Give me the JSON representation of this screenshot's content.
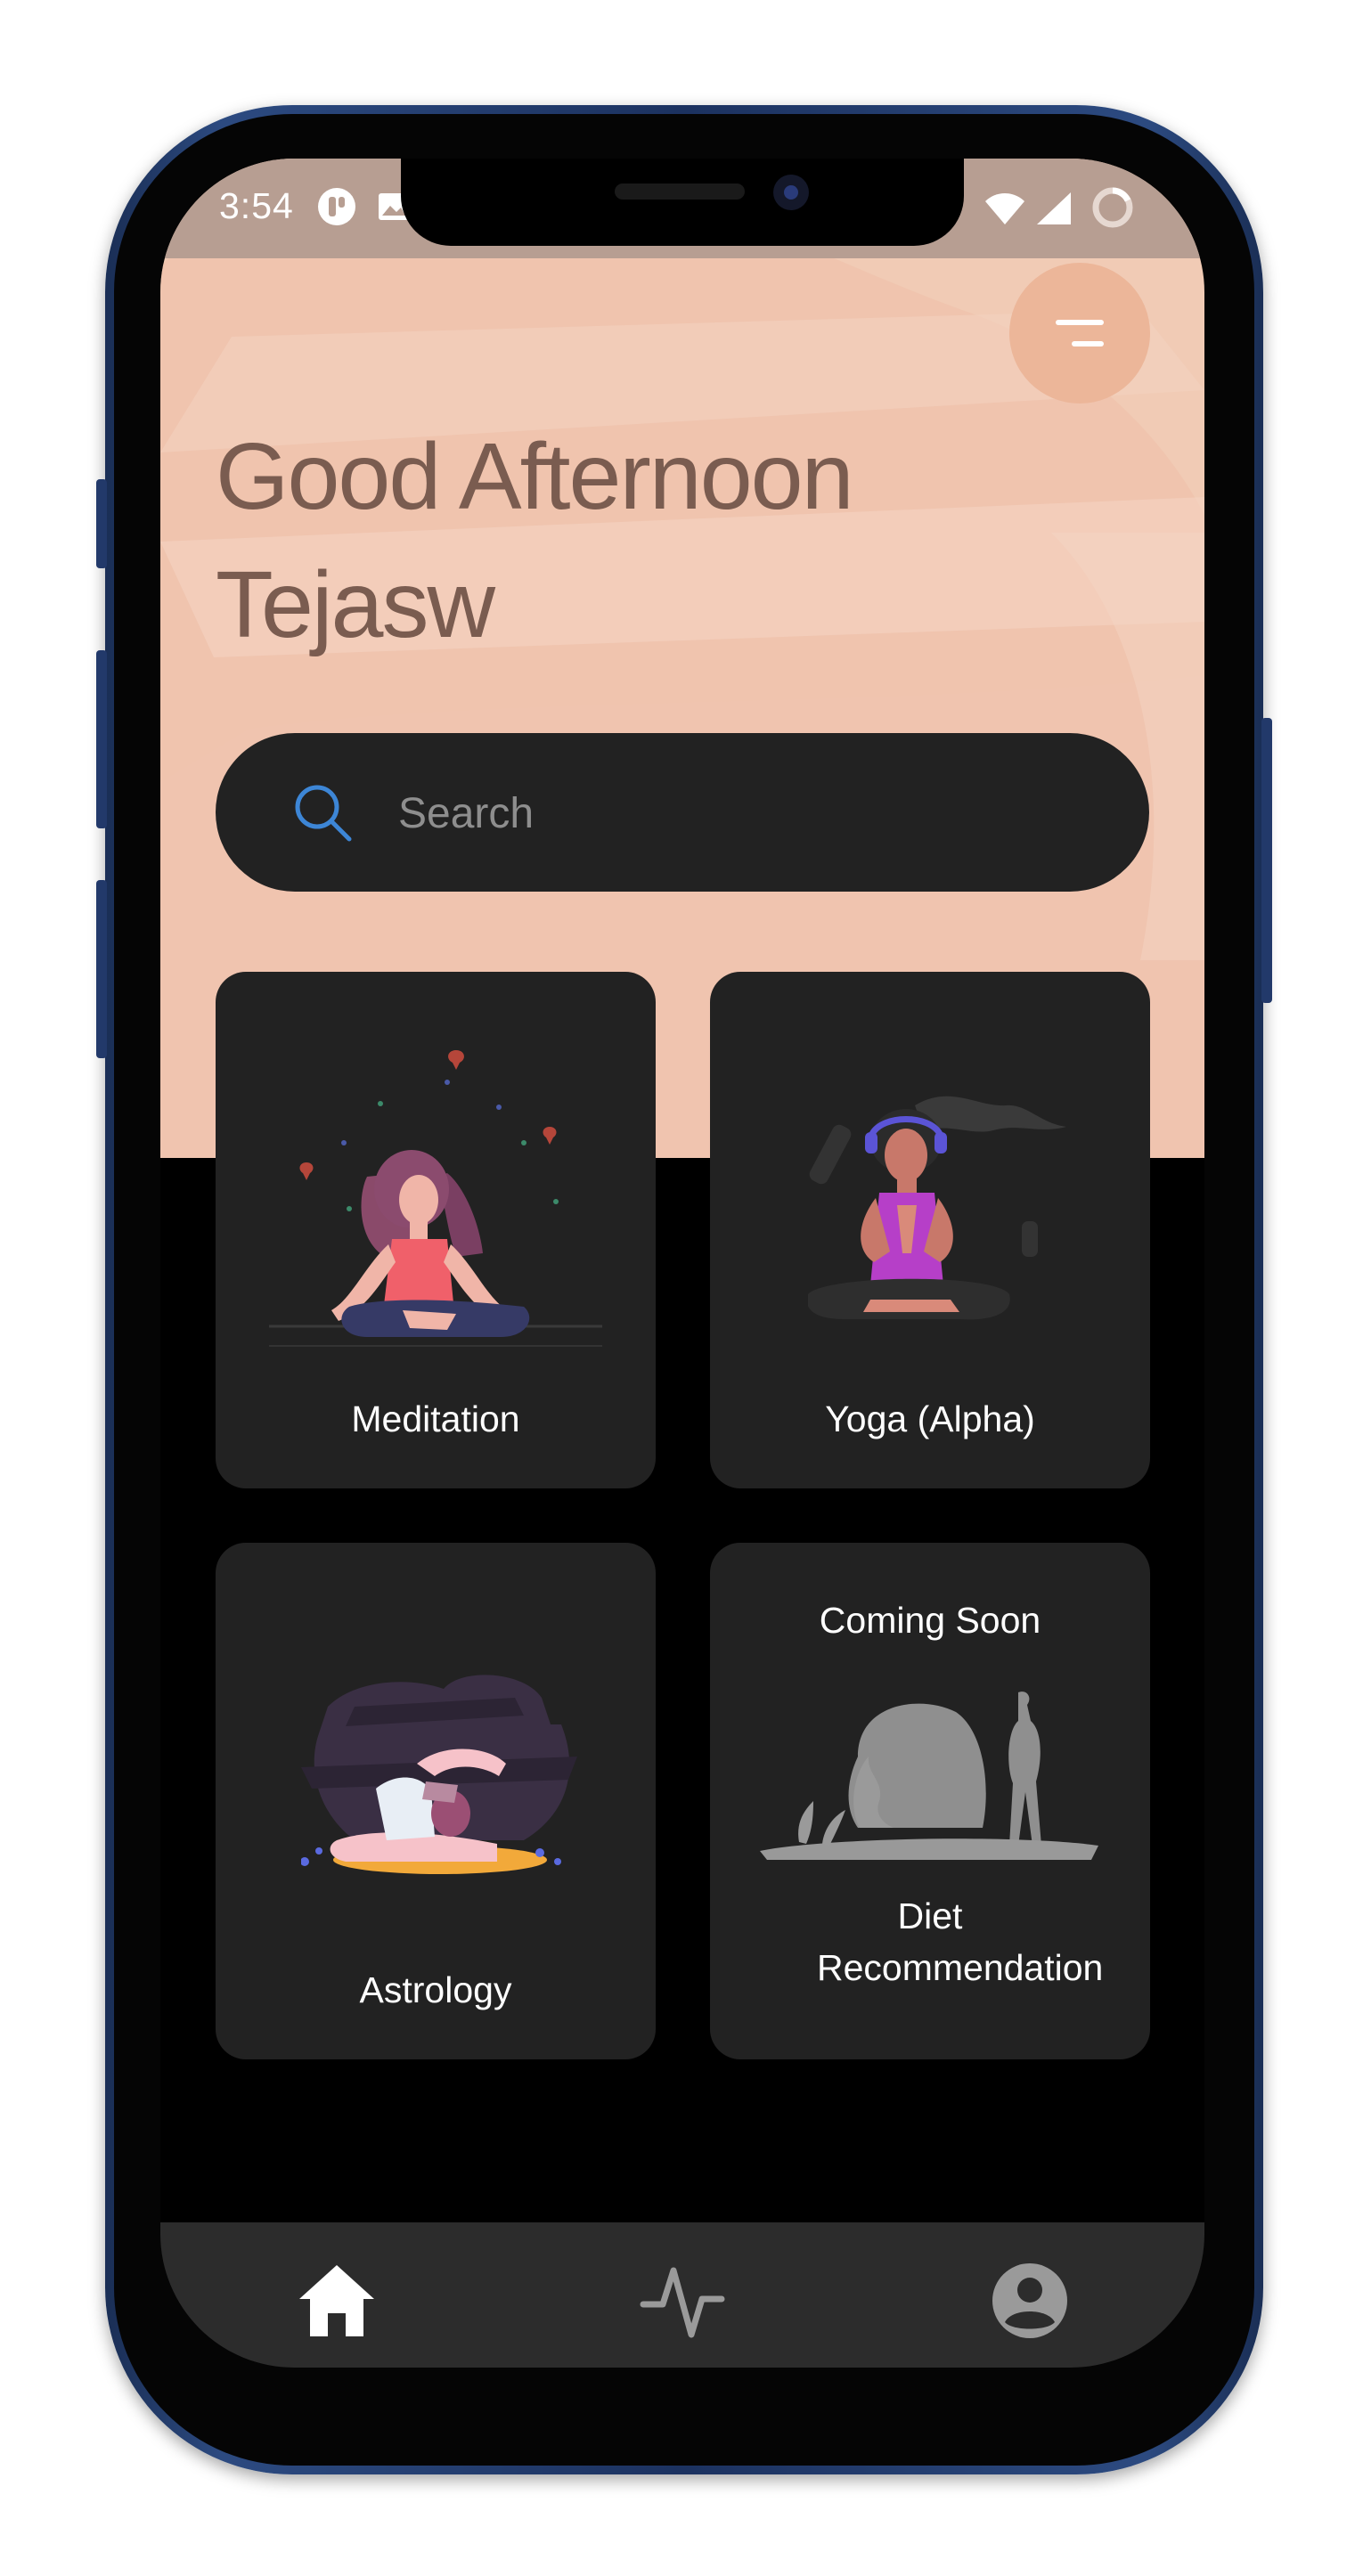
{
  "status_bar": {
    "time": "3:54",
    "icons": [
      "app-notification-icon",
      "image-notification-icon",
      "wifi-icon",
      "cellular-signal-icon",
      "battery-ring-icon"
    ]
  },
  "header": {
    "greeting": "Good Afternoon",
    "user_name": "Tejasw",
    "menu_icon": "menu-icon",
    "background_color": "#f1cbb5"
  },
  "search": {
    "placeholder": "Search",
    "value": "",
    "icon": "search-icon",
    "icon_color": "#3d86d6"
  },
  "cards": [
    {
      "label": "Meditation",
      "art": "meditation-illustration"
    },
    {
      "label": "Yoga (Alpha)",
      "art": "yoga-illustration"
    },
    {
      "label": "Astrology",
      "art": "astrology-illustration"
    },
    {
      "label": "Diet Recommendation",
      "badge": "Coming Soon",
      "art": "diet-illustration"
    }
  ],
  "bottom_nav": {
    "items": [
      {
        "name": "home",
        "icon": "home-icon",
        "active": true
      },
      {
        "name": "activity",
        "icon": "activity-pulse-icon",
        "active": false
      },
      {
        "name": "profile",
        "icon": "account-circle-icon",
        "active": false
      }
    ]
  },
  "colors": {
    "card_background": "#222222",
    "screen_background": "#000000",
    "nav_background": "#2c2c2c",
    "accent_peach": "#ecb699"
  }
}
